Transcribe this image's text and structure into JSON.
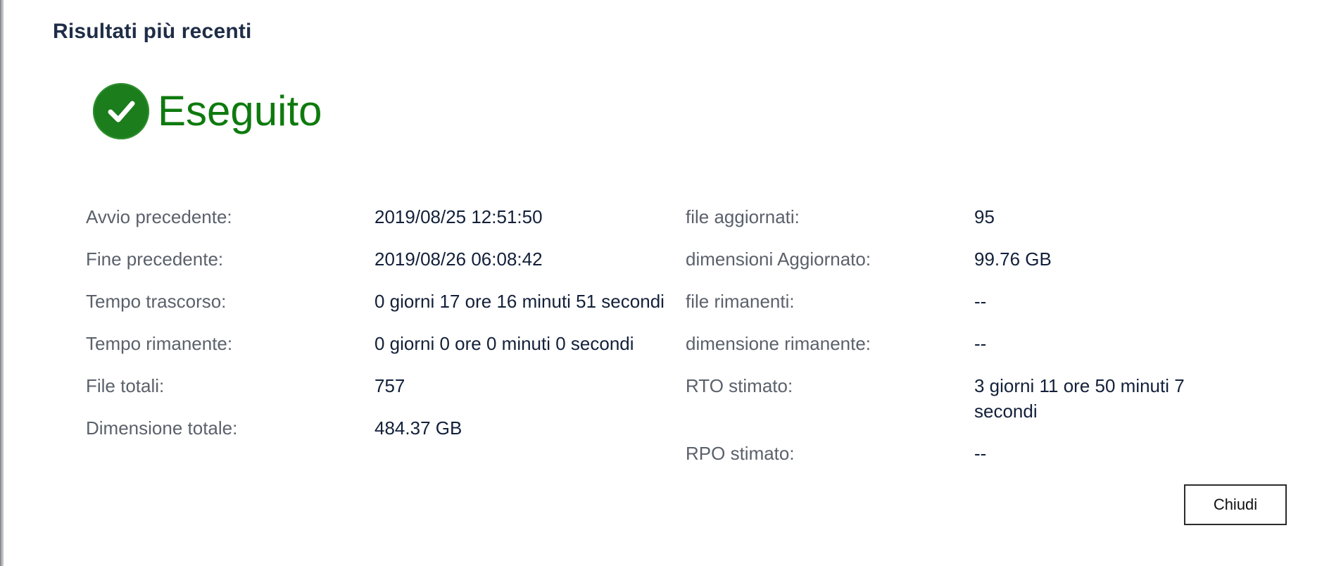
{
  "dialog": {
    "title": "Risultati più recenti",
    "status": {
      "label": "Eseguito",
      "icon": "check-circle-icon",
      "color": "#0e7a0e"
    },
    "left_fields": [
      {
        "label": "Avvio precedente:",
        "value": "2019/08/25 12:51:50"
      },
      {
        "label": "Fine precedente:",
        "value": "2019/08/26 06:08:42"
      },
      {
        "label": "Tempo trascorso:",
        "value": "0 giorni 17 ore 16 minuti 51 secondi"
      },
      {
        "label": "Tempo rimanente:",
        "value": "0 giorni 0 ore 0 minuti 0 secondi"
      },
      {
        "label": "File totali:",
        "value": "757"
      },
      {
        "label": "Dimensione totale:",
        "value": "484.37 GB"
      }
    ],
    "right_fields": [
      {
        "label": "file aggiornati:",
        "value": "95"
      },
      {
        "label": "dimensioni Aggiornato:",
        "value": "99.76 GB"
      },
      {
        "label": "file rimanenti:",
        "value": "--"
      },
      {
        "label": "dimensione rimanente:",
        "value": "--"
      },
      {
        "label": "RTO stimato:",
        "value": "3 giorni 11 ore 50 minuti 7 secondi"
      },
      {
        "label": "RPO stimato:",
        "value": "--"
      }
    ],
    "close_label": "Chiudi"
  }
}
